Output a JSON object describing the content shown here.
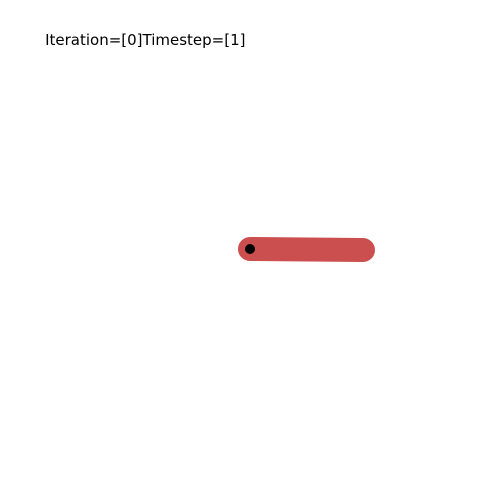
{
  "hud": {
    "iteration_label": "Iteration=",
    "iteration_value": "[0]",
    "timestep_label": "Timestep=",
    "timestep_value": "[1]"
  },
  "pendulum": {
    "pole_color": "#cc4f4f",
    "pivot_color": "#000000",
    "angle_degrees_from_upright": 90.5
  }
}
